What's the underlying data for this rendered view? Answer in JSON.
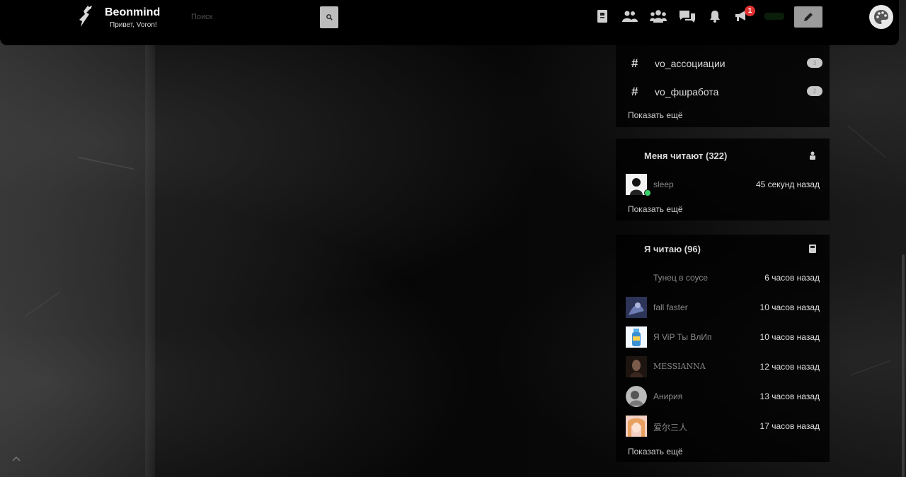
{
  "header": {
    "brand": "Beonmind",
    "greeting": "Привет, Voron!",
    "search_placeholder": "Поиск",
    "notification_badge": "1"
  },
  "icons": {
    "logo": "crow-logo-icon",
    "search": "search-icon",
    "pencil": "pencil-icon",
    "palette": "palette-icon"
  },
  "tags": {
    "items": [
      {
        "label": "vo_ассоциации",
        "count": "3"
      },
      {
        "label": "vo_фшработа",
        "count": "2"
      }
    ],
    "show_more": "Показать ещё"
  },
  "followers": {
    "title": "Меня читают (322)",
    "users": [
      {
        "name": "sleep",
        "time": "45 секунд назад",
        "online": true
      }
    ],
    "show_more": "Показать ещё"
  },
  "following": {
    "title": "Я читаю (96)",
    "users": [
      {
        "name": "Тунец в соусе",
        "time": "6 часов назад"
      },
      {
        "name": "fall faster",
        "time": "10 часов назад"
      },
      {
        "name": "Я ViP Ты ВлИп",
        "time": "10 часов назад"
      },
      {
        "name": "MESSIANNA",
        "time": "12 часов назад"
      },
      {
        "name": "Анирия",
        "time": "13 часов назад"
      },
      {
        "name": "爱尔三人",
        "time": "17 часов назад"
      }
    ],
    "show_more": "Показать ещё"
  },
  "colors": {
    "accent_badge": "#e03131",
    "online": "#3cd16a"
  }
}
